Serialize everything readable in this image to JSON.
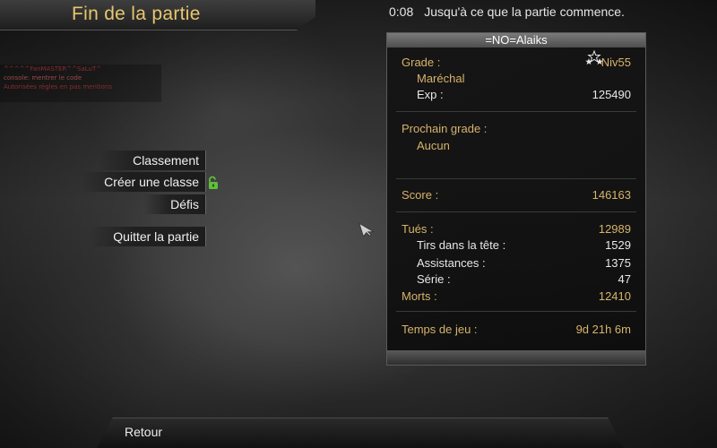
{
  "header": {
    "title": "Fin de la partie"
  },
  "timer": {
    "time": "0:08",
    "message": "Jusqu'à ce que la partie commence."
  },
  "chat": {
    "lines": [
      "^^^^^FanMASTER^^SaLuT^",
      "console:   mentrer   le   code",
      "Autorisées   règles   en   pas   mentions"
    ]
  },
  "menu": {
    "items": [
      {
        "label": "Classement"
      },
      {
        "label": "Créer une classe"
      },
      {
        "label": "Défis"
      },
      {
        "label": "Quitter la partie"
      }
    ]
  },
  "stats": {
    "player_name": "=NO=Alaiks",
    "grade_label": "Grade :",
    "level": "Niv55",
    "rank_name": "Maréchal",
    "exp_label": "Exp :",
    "exp_value": "125490",
    "next_grade_label": "Prochain grade :",
    "next_grade_value": "Aucun",
    "score_label": "Score :",
    "score_value": "146163",
    "kills_label": "Tués :",
    "kills_value": "12989",
    "headshots_label": "Tirs dans la tête :",
    "headshots_value": "1529",
    "assists_label": "Assistances :",
    "assists_value": "1375",
    "streak_label": "Série :",
    "streak_value": "47",
    "deaths_label": "Morts :",
    "deaths_value": "12410",
    "playtime_label": "Temps de jeu :",
    "playtime_value": "9d 21h 6m"
  },
  "footer": {
    "back_label": "Retour"
  },
  "colors": {
    "accent_gold": "#d7b36a",
    "title_gold": "#e8c66e",
    "lock_green": "#5fbf3a"
  },
  "icons": {
    "lock": "unlocked-padlock-icon",
    "stars": "rank-stars-icon",
    "cursor": "mouse-pointer-icon"
  }
}
